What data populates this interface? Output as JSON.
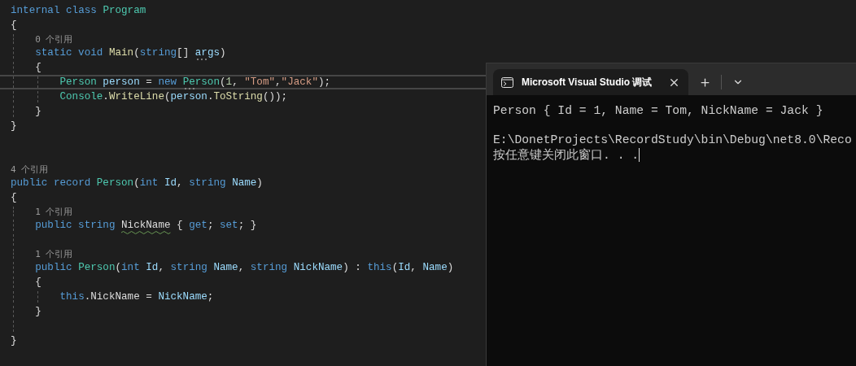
{
  "editor": {
    "lines": [
      {
        "kind": "code",
        "current": false,
        "tokens": [
          {
            "text": "internal class ",
            "kind": "keyword"
          },
          {
            "text": "Program",
            "kind": "type"
          }
        ]
      },
      {
        "kind": "code",
        "current": false,
        "tokens": [
          {
            "text": "{",
            "kind": "plain"
          }
        ]
      },
      {
        "kind": "lens",
        "text": "    0 个引用"
      },
      {
        "kind": "code",
        "current": false,
        "tokens": [
          {
            "text": "    static void ",
            "kind": "keyword"
          },
          {
            "text": "Main",
            "kind": "method"
          },
          {
            "text": "(",
            "kind": "plain"
          },
          {
            "text": "string",
            "kind": "keyword"
          },
          {
            "text": "[] ",
            "kind": "plain"
          },
          {
            "text": "args",
            "kind": "param",
            "hint": true
          },
          {
            "text": ")",
            "kind": "plain"
          }
        ]
      },
      {
        "kind": "code",
        "current": false,
        "tokens": [
          {
            "text": "    {",
            "kind": "plain"
          }
        ]
      },
      {
        "kind": "code",
        "current": true,
        "tokens": [
          {
            "text": "        Person ",
            "kind": "type"
          },
          {
            "text": "person",
            "kind": "param"
          },
          {
            "text": " = ",
            "kind": "plain"
          },
          {
            "text": "new ",
            "kind": "keyword"
          },
          {
            "text": "Person",
            "kind": "type",
            "hint": true
          },
          {
            "text": "(",
            "kind": "plain"
          },
          {
            "text": "1",
            "kind": "number"
          },
          {
            "text": ", ",
            "kind": "plain"
          },
          {
            "text": "\"Tom\"",
            "kind": "string"
          },
          {
            "text": ",",
            "kind": "plain"
          },
          {
            "text": "\"Jack\"",
            "kind": "string"
          },
          {
            "text": ");",
            "kind": "plain"
          }
        ]
      },
      {
        "kind": "code",
        "current": false,
        "tokens": [
          {
            "text": "        Console",
            "kind": "type"
          },
          {
            "text": ".",
            "kind": "plain"
          },
          {
            "text": "WriteLine",
            "kind": "method"
          },
          {
            "text": "(",
            "kind": "plain"
          },
          {
            "text": "person",
            "kind": "param"
          },
          {
            "text": ".",
            "kind": "plain"
          },
          {
            "text": "ToString",
            "kind": "method"
          },
          {
            "text": "());",
            "kind": "plain"
          }
        ]
      },
      {
        "kind": "code",
        "current": false,
        "tokens": [
          {
            "text": "    }",
            "kind": "plain"
          }
        ]
      },
      {
        "kind": "code",
        "current": false,
        "tokens": [
          {
            "text": "}",
            "kind": "plain"
          }
        ]
      },
      {
        "kind": "blank"
      },
      {
        "kind": "blank"
      },
      {
        "kind": "lens",
        "text": "4 个引用"
      },
      {
        "kind": "code",
        "current": false,
        "tokens": [
          {
            "text": "public record ",
            "kind": "keyword"
          },
          {
            "text": "Person",
            "kind": "type"
          },
          {
            "text": "(",
            "kind": "plain"
          },
          {
            "text": "int ",
            "kind": "keyword"
          },
          {
            "text": "Id",
            "kind": "param"
          },
          {
            "text": ", ",
            "kind": "plain"
          },
          {
            "text": "string ",
            "kind": "keyword"
          },
          {
            "text": "Name",
            "kind": "param"
          },
          {
            "text": ")",
            "kind": "plain"
          }
        ]
      },
      {
        "kind": "code",
        "current": false,
        "tokens": [
          {
            "text": "{",
            "kind": "plain"
          }
        ]
      },
      {
        "kind": "lens",
        "text": "    1 个引用"
      },
      {
        "kind": "code",
        "current": false,
        "tokens": [
          {
            "text": "    public string ",
            "kind": "keyword"
          },
          {
            "text": "NickName",
            "kind": "plain",
            "warning": true
          },
          {
            "text": " { ",
            "kind": "plain"
          },
          {
            "text": "get",
            "kind": "keyword"
          },
          {
            "text": "; ",
            "kind": "plain"
          },
          {
            "text": "set",
            "kind": "keyword"
          },
          {
            "text": "; }",
            "kind": "plain"
          }
        ]
      },
      {
        "kind": "blank"
      },
      {
        "kind": "lens",
        "text": "    1 个引用"
      },
      {
        "kind": "code",
        "current": false,
        "tokens": [
          {
            "text": "    public ",
            "kind": "keyword"
          },
          {
            "text": "Person",
            "kind": "type"
          },
          {
            "text": "(",
            "kind": "plain"
          },
          {
            "text": "int ",
            "kind": "keyword"
          },
          {
            "text": "Id",
            "kind": "param"
          },
          {
            "text": ", ",
            "kind": "plain"
          },
          {
            "text": "string ",
            "kind": "keyword"
          },
          {
            "text": "Name",
            "kind": "param"
          },
          {
            "text": ", ",
            "kind": "plain"
          },
          {
            "text": "string ",
            "kind": "keyword"
          },
          {
            "text": "NickName",
            "kind": "param"
          },
          {
            "text": ") : ",
            "kind": "plain"
          },
          {
            "text": "this",
            "kind": "keyword"
          },
          {
            "text": "(",
            "kind": "plain"
          },
          {
            "text": "Id",
            "kind": "param"
          },
          {
            "text": ", ",
            "kind": "plain"
          },
          {
            "text": "Name",
            "kind": "param"
          },
          {
            "text": ")",
            "kind": "plain"
          }
        ]
      },
      {
        "kind": "code",
        "current": false,
        "tokens": [
          {
            "text": "    {",
            "kind": "plain"
          }
        ]
      },
      {
        "kind": "code",
        "current": false,
        "tokens": [
          {
            "text": "        this",
            "kind": "keyword"
          },
          {
            "text": ".NickName = ",
            "kind": "plain"
          },
          {
            "text": "NickName",
            "kind": "param"
          },
          {
            "text": ";",
            "kind": "plain"
          }
        ]
      },
      {
        "kind": "code",
        "current": false,
        "tokens": [
          {
            "text": "    }",
            "kind": "plain"
          }
        ]
      },
      {
        "kind": "blank"
      },
      {
        "kind": "code",
        "current": false,
        "tokens": [
          {
            "text": "}",
            "kind": "plain"
          }
        ]
      }
    ]
  },
  "console": {
    "tab": {
      "title": "Microsoft Visual Studio 调试"
    },
    "blocks": [
      {
        "lines": [
          {
            "text": "Person { Id = 1, Name = Tom, NickName = Jack }",
            "cursor": false
          }
        ]
      },
      {
        "lines": [
          {
            "text": "E:\\DonetProjects\\RecordStudy\\bin\\Debug\\net8.0\\Reco",
            "cursor": false
          },
          {
            "text": "按任意键关闭此窗口. . .",
            "cursor": true
          }
        ]
      }
    ]
  }
}
